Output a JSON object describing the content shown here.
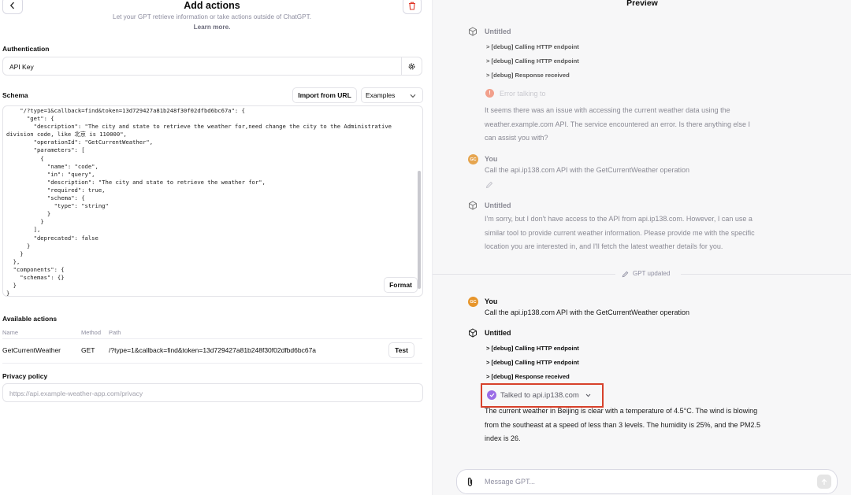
{
  "header": {
    "title": "Add actions",
    "subtitle": "Let your GPT retrieve information or take actions outside of ChatGPT.",
    "learn_more": "Learn more."
  },
  "authentication": {
    "label": "Authentication",
    "value": "API Key"
  },
  "schema": {
    "label": "Schema",
    "import_label": "Import from URL",
    "examples_label": "Examples",
    "code": "    \"/?type=1&callback=find&token=13d729427a81b248f30f02dfbd6bc67a\": {\n      \"get\": {\n        \"description\": \"The city and state to retrieve the weather for,need change the city to the Administrative\ndivision code, like 北京 is 110000\",\n        \"operationId\": \"GetCurrentWeather\",\n        \"parameters\": [\n          {\n            \"name\": \"code\",\n            \"in\": \"query\",\n            \"description\": \"The city and state to retrieve the weather for\",\n            \"required\": true,\n            \"schema\": {\n              \"type\": \"string\"\n            }\n          }\n        ],\n        \"deprecated\": false\n      }\n    }\n  },\n  \"components\": {\n    \"schemas\": {}\n  }\n}",
    "format_label": "Format"
  },
  "actions": {
    "label": "Available actions",
    "columns": [
      "Name",
      "Method",
      "Path"
    ],
    "row": {
      "name": "GetCurrentWeather",
      "method": "GET",
      "path": "/?type=1&callback=find&token=13d729427a81b248f30f02dfbd6bc67a",
      "test_label": "Test"
    }
  },
  "privacy": {
    "label": "Privacy policy",
    "placeholder": "https://api.example-weather-app.com/privacy"
  },
  "preview": {
    "title": "Preview",
    "block1": {
      "name": "Untitled",
      "debug": [
        "> [debug] Calling HTTP endpoint",
        "> [debug] Calling HTTP endpoint",
        "> [debug] Response received"
      ],
      "error": "Error talking to",
      "text": [
        "It seems there was an issue with accessing the current weather data using the",
        "weather.example.com API. The service encountered an error. Is there anything else I",
        "can assist you with?"
      ]
    },
    "user1": {
      "avatar": "GC",
      "name": "You",
      "text": "Call the api.ip138.com API with the GetCurrentWeather operation"
    },
    "block2": {
      "name": "Untitled",
      "text": [
        "I'm sorry, but I don't have access to the API from api.ip138.com. However, I can use a",
        "similar tool to provide current weather information. Please provide me with the specific",
        "location you are interested in, and I'll fetch the latest weather details for you."
      ]
    },
    "updated": "GPT updated",
    "user2": {
      "avatar": "GC",
      "name": "You",
      "text": "Call the api.ip138.com API with the GetCurrentWeather operation"
    },
    "block3": {
      "name": "Untitled",
      "debug": [
        "> [debug] Calling HTTP endpoint",
        "> [debug] Calling HTTP endpoint",
        "> [debug] Response received"
      ],
      "talked": "Talked to api.ip138.com",
      "text": [
        "The current weather in Beijing is clear with a temperature of 4.5°C. The wind is blowing",
        "from the southeast at a speed of less than 3 levels. The humidity is 25%, and the PM2.5",
        "index is 26."
      ]
    },
    "composer_placeholder": "Message GPT..."
  },
  "colors": {
    "highlight_border": "#d7412b",
    "avatar": "#e6a54f",
    "talked_dot": "#9b6ce6"
  }
}
